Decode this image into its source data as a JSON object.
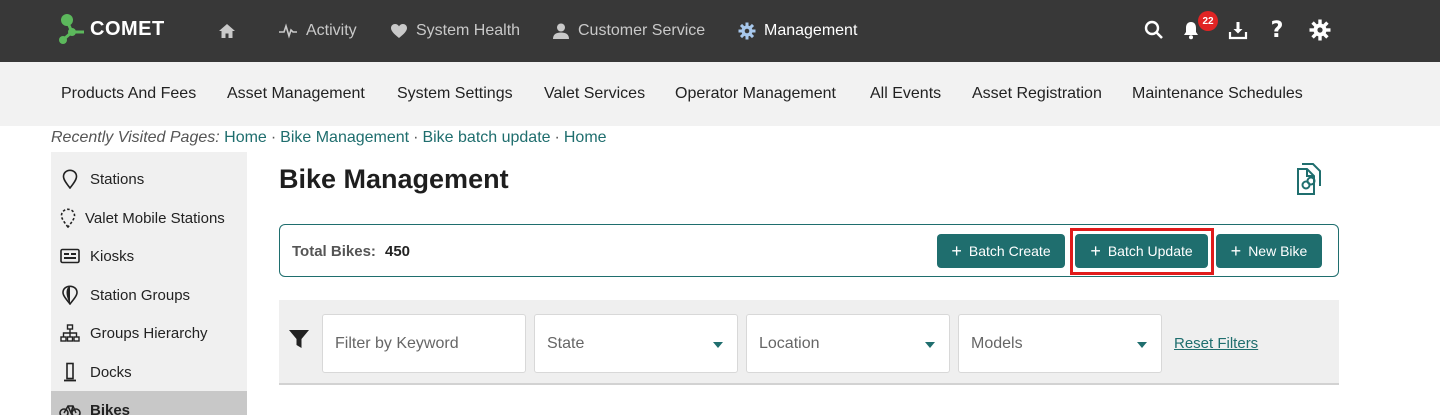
{
  "app": {
    "logo_text": "COMET"
  },
  "topnav": {
    "items": [
      {
        "label": ""
      },
      {
        "label": "Activity"
      },
      {
        "label": "System Health"
      },
      {
        "label": "Customer Service"
      },
      {
        "label": "Management"
      }
    ],
    "notifications_count": "22"
  },
  "subnav": {
    "items": [
      "Products And Fees",
      "Asset Management",
      "System Settings",
      "Valet Services",
      "Operator Management",
      "All Events",
      "Asset Registration",
      "Maintenance Schedules"
    ]
  },
  "breadcrumb": {
    "prefix": "Recently Visited Pages:",
    "links": [
      "Home",
      "Bike Management",
      "Bike batch update",
      "Home"
    ],
    "separator": "·"
  },
  "sidebar": {
    "items": [
      {
        "label": "Stations",
        "icon": "map-pin-icon"
      },
      {
        "label": "Valet Mobile Stations",
        "icon": "mobile-station-icon"
      },
      {
        "label": "Kiosks",
        "icon": "kiosk-icon"
      },
      {
        "label": "Station Groups",
        "icon": "station-groups-icon"
      },
      {
        "label": "Groups Hierarchy",
        "icon": "hierarchy-icon"
      },
      {
        "label": "Docks",
        "icon": "dock-icon"
      },
      {
        "label": "Bikes",
        "icon": "bike-icon"
      }
    ],
    "active": "Bikes"
  },
  "main": {
    "title": "Bike Management",
    "total_label": "Total Bikes:",
    "total_value": "450",
    "buttons": {
      "batch_create": "Batch Create",
      "batch_update": "Batch Update",
      "new_bike": "New Bike"
    }
  },
  "filters": {
    "keyword_placeholder": "Filter by Keyword",
    "state": "State",
    "location": "Location",
    "models": "Models",
    "reset": "Reset Filters"
  },
  "colors": {
    "topbar": "#383838",
    "accent": "#1f6e6e",
    "badge": "#e02424",
    "highlight": "#e01b1b"
  }
}
